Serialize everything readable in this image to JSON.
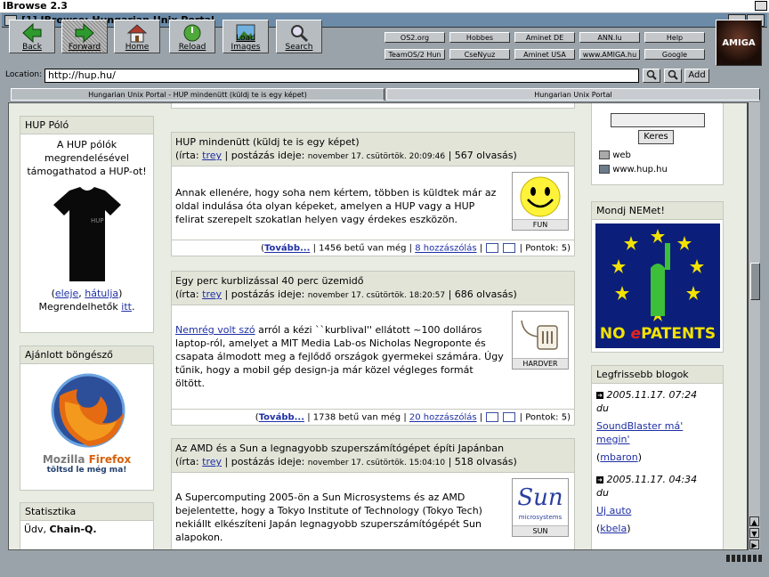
{
  "screen_title": "IBrowse 2.3",
  "window_title": "[1] IBrowse: Hungarian Unix Portal",
  "toolbar": {
    "back": "Back",
    "forward": "Forward",
    "home": "Home",
    "reload": "Reload",
    "load_images": "Load Images",
    "search": "Search"
  },
  "hotlist": [
    "OS2.org",
    "Hobbes",
    "Aminet DE",
    "ANN.lu",
    "Help",
    "TeamOS/2 Hun",
    "CseNyuz",
    "Aminet USA",
    "www.AMIGA.hu",
    "Google"
  ],
  "amiga_logo": "AMIGA",
  "location": {
    "label": "Location:",
    "url": "http://hup.hu/",
    "add": "Add"
  },
  "tabs": [
    "Hungarian Unix Portal - HUP mindenütt (küldj te is egy képet)",
    "Hungarian Unix Portal"
  ],
  "left": {
    "polo": {
      "title": "HUP Póló",
      "text": "A HUP pólók megrendelésével támogathatod a HUP-ot!",
      "link_front": "eleje",
      "link_back": "hátulja",
      "order_text": "Megrendelhetők",
      "order_link": "itt"
    },
    "browser": {
      "title": "Ajánlott böngésző",
      "brand_a": "Mozilla",
      "brand_b": "Firefox",
      "tagline": "töltsd le még ma!"
    },
    "stats": {
      "title": "Statisztika",
      "greeting": "Üdv,",
      "user": "Chain-Q."
    }
  },
  "articles": [
    {
      "title": "HUP mindenütt (küldj te is egy képet)",
      "author_prefix": "(írta:",
      "author": "trey",
      "meta_sep": "| postázás ideje:",
      "date": "november 17. csütörtök. 20:09:46",
      "views": "| 567 olvasás)",
      "body": "Annak ellenére, hogy soha nem kértem, többen is küldtek már az oldal indulása óta olyan képeket, amelyen a HUP vagy a HUP felirat szerepelt szokatlan helyen vagy érdekes eszközön.",
      "topic": "FUN",
      "more": "Tovább...",
      "size": "| 1456 betű van még |",
      "comments": "8 hozzászólás",
      "points": "| Pontok: 5)"
    },
    {
      "title": "Egy perc kurblizással 40 perc üzemidő",
      "author_prefix": "(írta:",
      "author": "trey",
      "meta_sep": "| postázás ideje:",
      "date": "november 17. csütörtök. 18:20:57",
      "views": "| 686 olvasás)",
      "body_link": "Nemrég volt szó",
      "body": " arról a kézi ``kurblival'' ellátott ~100 dolláros laptop-ról, amelyet a MIT Media Lab-os Nicholas Negroponte és csapata álmodott meg a fejlődő országok gyermekei számára. Úgy tűnik, hogy a mobil gép design-ja már közel végleges formát öltött.",
      "topic": "HARDVER",
      "more": "Tovább...",
      "size": "| 1738 betű van még |",
      "comments": "20 hozzászólás",
      "points": "| Pontok: 5)"
    },
    {
      "title": "Az AMD és a Sun a legnagyobb szuperszámítógépet építi Japánban",
      "author_prefix": "(írta:",
      "author": "trey",
      "meta_sep": "| postázás ideje:",
      "date": "november 17. csütörtök. 15:04:10",
      "views": "| 518 olvasás)",
      "body": "A Supercomputing 2005-ön a Sun Microsystems és az AMD bejelentette, hogy a Tokyo Institute of Technology (Tokyo Tech) nekiállt elkészíteni Japán legnagyobb szuperszámítógépét Sun alapokon.",
      "topic": "SUN",
      "topic_logo": "Sun",
      "topic_logo_sub": "microsystems"
    }
  ],
  "right": {
    "search": {
      "button": "Keres",
      "opt_web": "web",
      "opt_hup": "www.hup.hu"
    },
    "nemet": {
      "title": "Mondj NEMet!",
      "banner_no": "NO ",
      "banner_e": "e",
      "banner_rest": "PATENTS"
    },
    "blogs": {
      "title": "Legfrissebb blogok",
      "items": [
        {
          "date": "2005.11.17. 07:24",
          "by": "du",
          "title": "SoundBlaster má' megin'",
          "user": "mbaron"
        },
        {
          "date": "2005.11.17. 04:34",
          "by": "du",
          "title": "Uj auto",
          "user": "kbela"
        }
      ]
    }
  },
  "colors": {
    "link": "#1e2fa5",
    "box_header": "#e2e4d8",
    "page_bg": "#e9ece3",
    "window_title": "#6b8ba8"
  }
}
